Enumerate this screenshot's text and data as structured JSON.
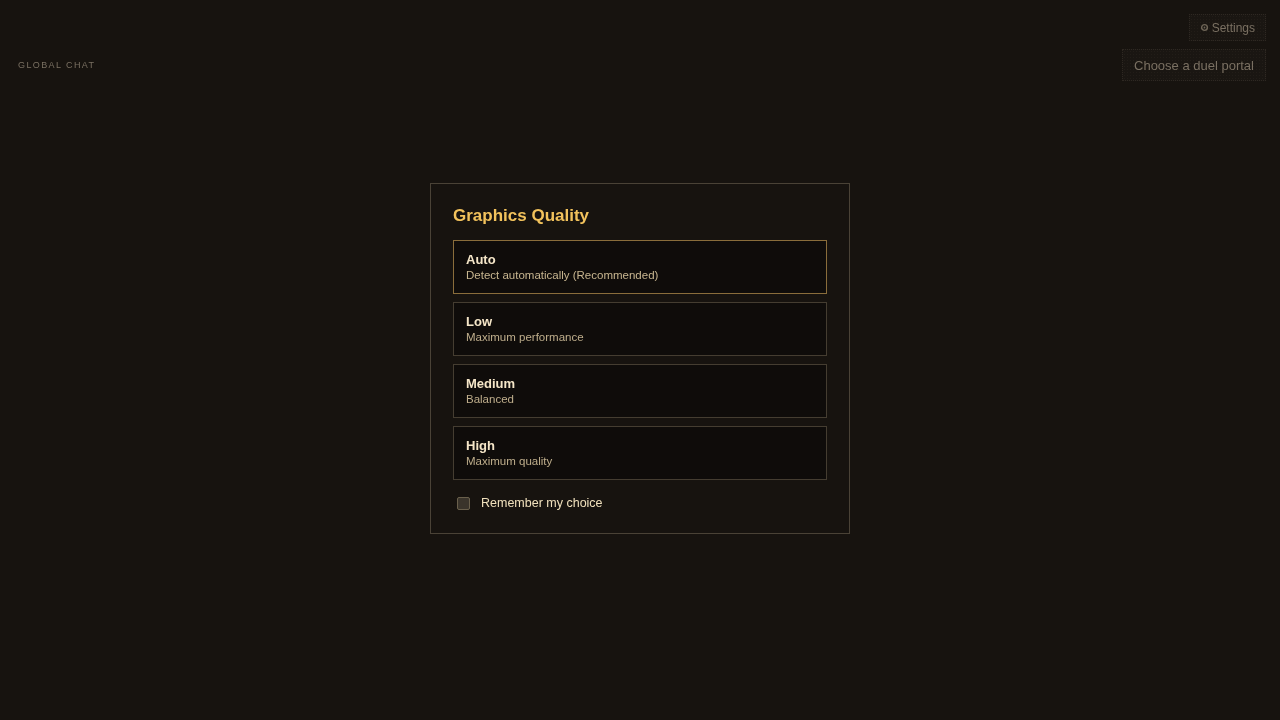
{
  "hud": {
    "chat_label": "GLOBAL CHAT",
    "settings_button": "Settings",
    "portal_button": "Choose a duel portal"
  },
  "dialog": {
    "title": "Graphics Quality",
    "options": [
      {
        "label": "Auto",
        "description": "Detect automatically (Recommended)",
        "selected": true
      },
      {
        "label": "Low",
        "description": "Maximum performance",
        "selected": false
      },
      {
        "label": "Medium",
        "description": "Balanced",
        "selected": false
      },
      {
        "label": "High",
        "description": "Maximum quality",
        "selected": false
      }
    ],
    "remember": {
      "label": "Remember my choice",
      "checked": false
    }
  }
}
